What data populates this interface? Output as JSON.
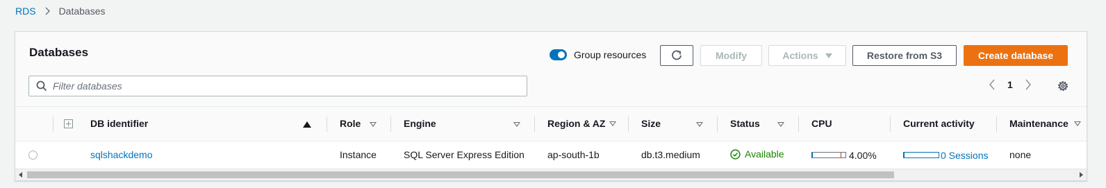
{
  "breadcrumb": {
    "root": "RDS",
    "current": "Databases"
  },
  "panel": {
    "title": "Databases",
    "group_resources_label": "Group resources",
    "group_resources_on": true,
    "buttons": {
      "modify": "Modify",
      "actions": "Actions",
      "restore": "Restore from S3",
      "create": "Create database"
    },
    "filter_placeholder": "Filter databases",
    "page": "1"
  },
  "table": {
    "columns": [
      "DB identifier",
      "Role",
      "Engine",
      "Region & AZ",
      "Size",
      "Status",
      "CPU",
      "Current activity",
      "Maintenance"
    ],
    "rows": [
      {
        "db_identifier": "sqlshackdemo",
        "role": "Instance",
        "engine": "SQL Server Express Edition",
        "region_az": "ap-south-1b",
        "size": "db.t3.medium",
        "status": "Available",
        "cpu": "4.00%",
        "cpu_value": 4.0,
        "current_activity": "0 Sessions",
        "maintenance": "none"
      }
    ]
  },
  "colors": {
    "accent": "#0073bb",
    "primary_button": "#ec7211",
    "status_available": "#1d8102",
    "breadcrumb_link": "#0073bb"
  }
}
